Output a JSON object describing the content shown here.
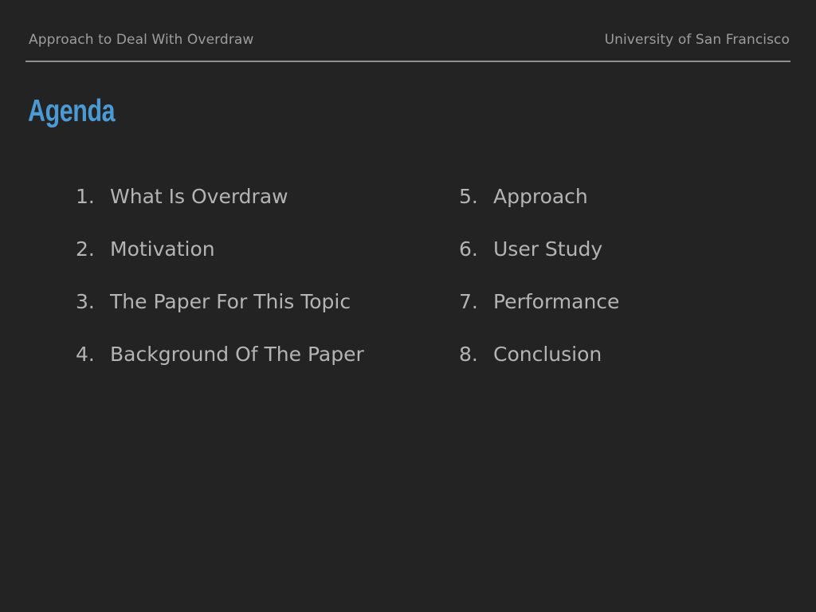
{
  "header": {
    "left": "Approach to Deal With Overdraw",
    "right": "University of San Francisco"
  },
  "title": "Agenda",
  "agenda": {
    "left": [
      {
        "num": "1.",
        "label": "What Is Overdraw"
      },
      {
        "num": "2.",
        "label": "Motivation"
      },
      {
        "num": "3.",
        "label": "The Paper For This Topic"
      },
      {
        "num": "4.",
        "label": "Background Of The Paper"
      }
    ],
    "right": [
      {
        "num": "5.",
        "label": "Approach"
      },
      {
        "num": "6.",
        "label": "User Study"
      },
      {
        "num": "7.",
        "label": "Performance"
      },
      {
        "num": "8.",
        "label": "Conclusion"
      }
    ]
  },
  "colors": {
    "background": "#232323",
    "title": "#4c9ad4",
    "text": "#b4b4b4",
    "divider": "#8e8e8e"
  }
}
